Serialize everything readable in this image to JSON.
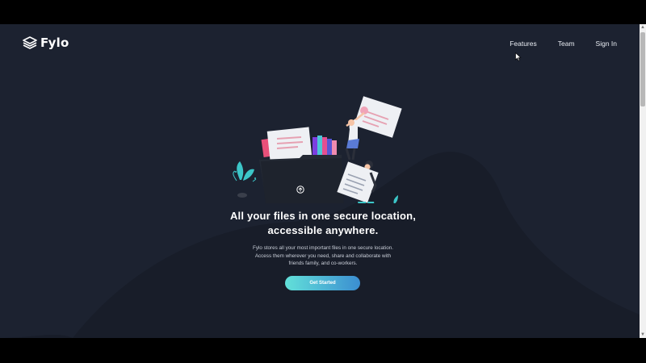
{
  "brand": {
    "name": "Fylo",
    "icon": "stacked-layers-icon"
  },
  "nav": {
    "items": [
      "Features",
      "Team",
      "Sign In"
    ]
  },
  "hero": {
    "headline_line1": "All your files in one secure location,",
    "headline_line2": "accessible anywhere.",
    "description_line1": "Fylo stores all your most important files in one secure location.",
    "description_line2": "Access them wherever you need, share and collaborate with",
    "description_line3": "friends family, and co-workers.",
    "cta_label": "Get Started",
    "illustration": "file-folder-people-illustration"
  },
  "colors": {
    "page_background": "#1c2230",
    "curve_background": "#181d29",
    "text": "#ffffff",
    "cta_gradient_start": "#62e0d9",
    "cta_gradient_end": "#3b8ed1"
  }
}
